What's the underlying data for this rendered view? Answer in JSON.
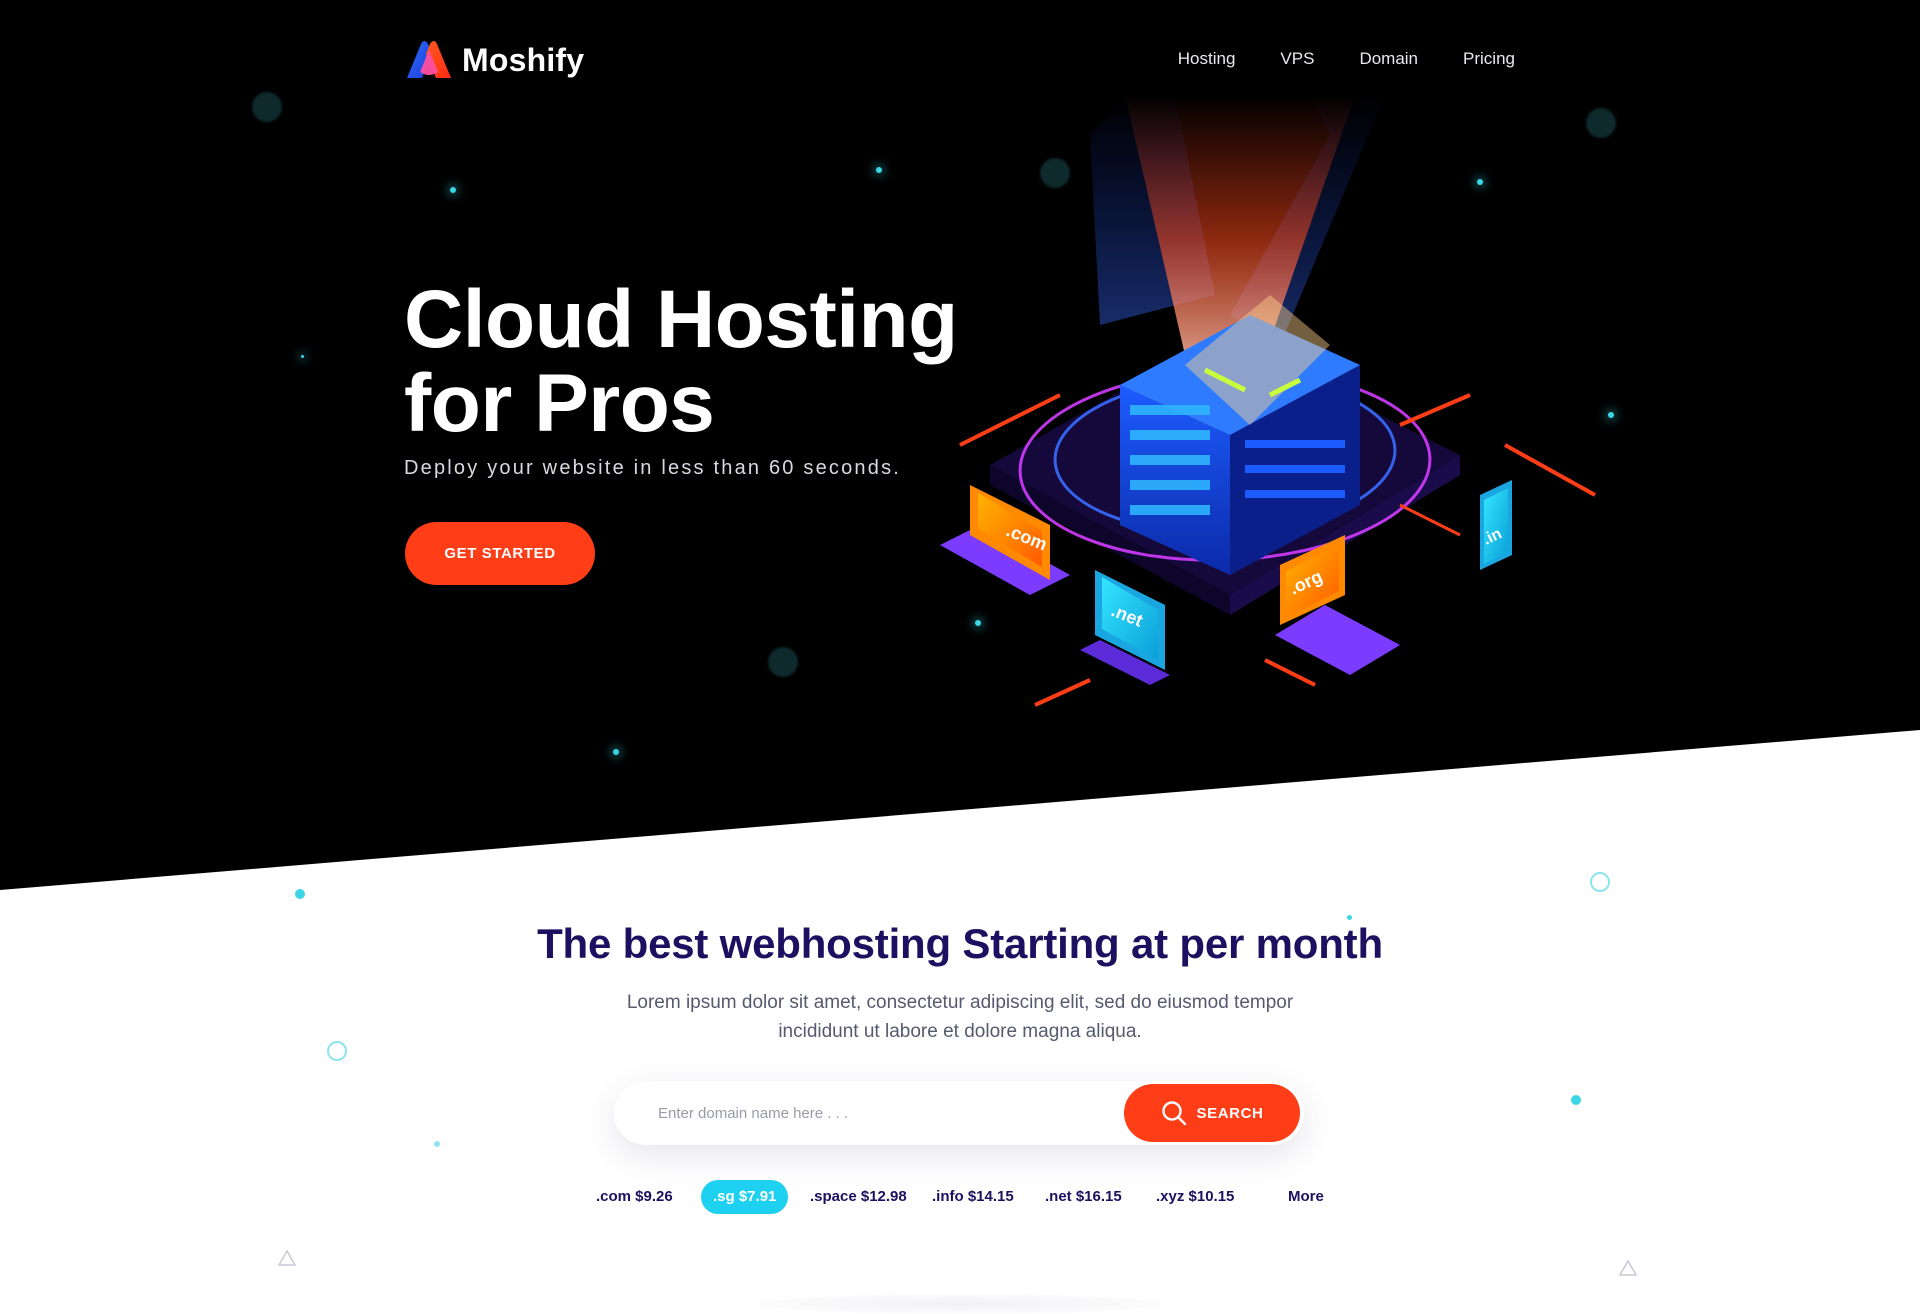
{
  "brand": {
    "name": "Moshify"
  },
  "nav": {
    "items": [
      "Hosting",
      "VPS",
      "Domain",
      "Pricing"
    ]
  },
  "hero": {
    "title_line1": "Cloud Hosting",
    "title_line2": "for Pros",
    "subtitle": "Deploy your website in less than 60 seconds.",
    "cta_label": "GET STARTED",
    "device_labels": [
      ".com",
      ".net",
      ".org",
      ".in"
    ]
  },
  "pricing_section": {
    "title": "The best webhosting Starting at per month",
    "description_line1": "Lorem ipsum dolor sit amet, consectetur adipiscing elit, sed do eiusmod tempor",
    "description_line2": "incididunt ut labore et dolore magna aliqua."
  },
  "search": {
    "placeholder": "Enter domain name here . . .",
    "button_label": "SEARCH"
  },
  "tld_prices": [
    {
      "label": ".com $9.26",
      "active": false
    },
    {
      "label": ".sg $7.91",
      "active": true
    },
    {
      "label": ".space $12.98",
      "active": false
    },
    {
      "label": ".info $14.15",
      "active": false
    },
    {
      "label": ".net $16.15",
      "active": false
    },
    {
      "label": ".xyz $10.15",
      "active": false
    }
  ],
  "more_label": "More",
  "colors": {
    "accent": "#ff3d16",
    "highlight": "#1fd1f0",
    "heading": "#1d1060",
    "hero_bg": "#000000"
  },
  "icons": [
    "moshify-logo-icon",
    "search-icon"
  ]
}
